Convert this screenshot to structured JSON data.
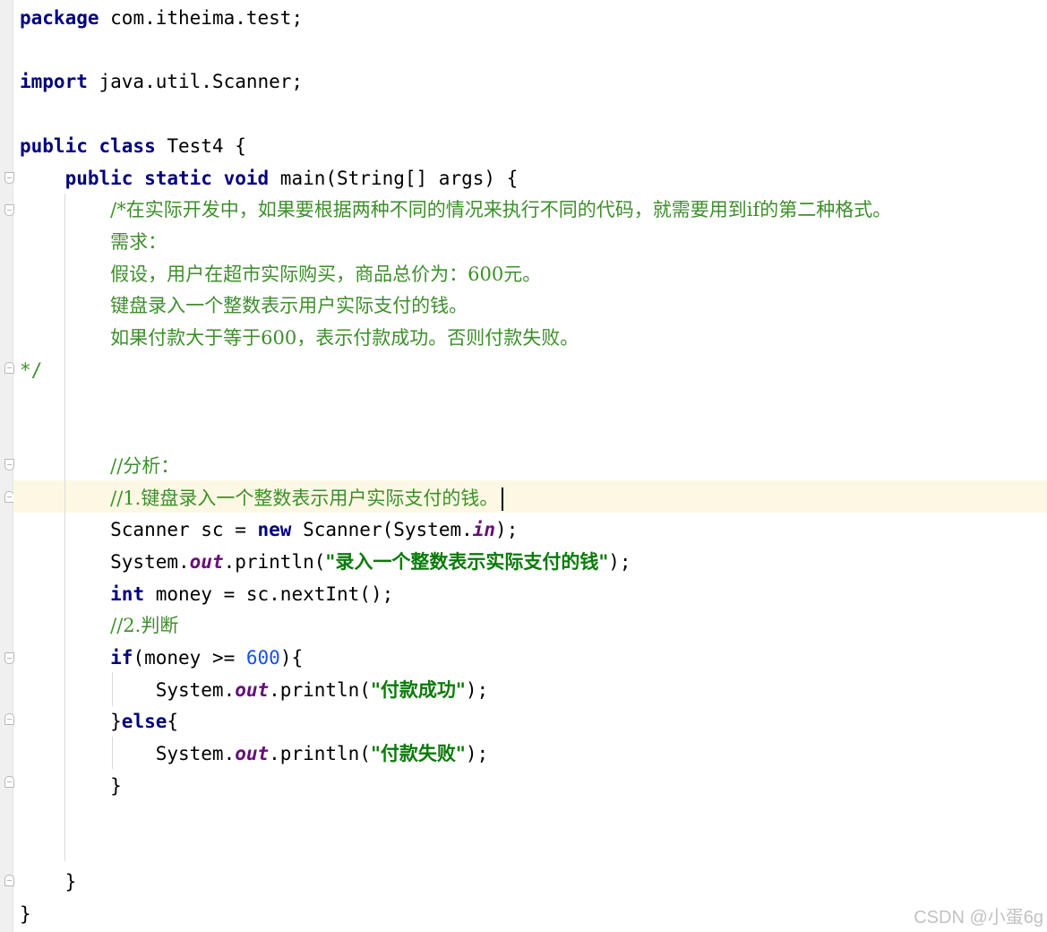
{
  "editor": {
    "language": "java",
    "caret_line": 16,
    "lines": [
      {
        "parts": [
          {
            "t": "package",
            "s": "kw"
          },
          {
            "t": " com.itheima.test;"
          }
        ]
      },
      {
        "parts": []
      },
      {
        "parts": [
          {
            "t": "import",
            "s": "kw"
          },
          {
            "t": " java.util.Scanner;"
          }
        ]
      },
      {
        "parts": []
      },
      {
        "parts": [
          {
            "t": "public class",
            "s": "kw"
          },
          {
            "t": " Test4 {"
          }
        ]
      },
      {
        "parts": [
          {
            "t": "    "
          },
          {
            "t": "public static void",
            "s": "kw"
          },
          {
            "t": " main(String[] args) {"
          }
        ]
      },
      {
        "parts": [
          {
            "t": "        "
          },
          {
            "t": "/*在实际开发中，如果要根据两种不同的情况来执行不同的代码，就需要用到if的第二种格式。",
            "s": "cm"
          }
        ]
      },
      {
        "parts": [
          {
            "t": "        "
          },
          {
            "t": "需求：",
            "s": "cm"
          }
        ]
      },
      {
        "parts": [
          {
            "t": "        "
          },
          {
            "t": "假设，用户在超市实际购买，商品总价为：600元。",
            "s": "cm"
          }
        ]
      },
      {
        "parts": [
          {
            "t": "        "
          },
          {
            "t": "键盘录入一个整数表示用户实际支付的钱。",
            "s": "cm"
          }
        ]
      },
      {
        "parts": [
          {
            "t": "        "
          },
          {
            "t": "如果付款大于等于600，表示付款成功。否则付款失败。",
            "s": "cm"
          }
        ]
      },
      {
        "parts": [
          {
            "t": "*/",
            "s": "cmm"
          }
        ]
      },
      {
        "parts": []
      },
      {
        "parts": []
      },
      {
        "parts": [
          {
            "t": "        "
          },
          {
            "t": "//分析：",
            "s": "cm"
          }
        ]
      },
      {
        "parts": [
          {
            "t": "        "
          },
          {
            "t": "//1.键盘录入一个整数表示用户实际支付的钱。",
            "s": "cm"
          }
        ]
      },
      {
        "parts": [
          {
            "t": "        Scanner sc = "
          },
          {
            "t": "new",
            "s": "kw"
          },
          {
            "t": " Scanner(System."
          },
          {
            "t": "in",
            "s": "field"
          },
          {
            "t": ");"
          }
        ]
      },
      {
        "parts": [
          {
            "t": "        System."
          },
          {
            "t": "out",
            "s": "field"
          },
          {
            "t": ".println("
          },
          {
            "t": "\"录入一个整数表示实际支付的钱\"",
            "s": "str"
          },
          {
            "t": ");"
          }
        ]
      },
      {
        "parts": [
          {
            "t": "        "
          },
          {
            "t": "int",
            "s": "kw"
          },
          {
            "t": " money = sc.nextInt();"
          }
        ]
      },
      {
        "parts": [
          {
            "t": "        "
          },
          {
            "t": "//2.判断",
            "s": "cm"
          }
        ]
      },
      {
        "parts": [
          {
            "t": "        "
          },
          {
            "t": "if",
            "s": "kw"
          },
          {
            "t": "(money >= "
          },
          {
            "t": "600",
            "s": "num"
          },
          {
            "t": "){"
          }
        ]
      },
      {
        "parts": [
          {
            "t": "            System."
          },
          {
            "t": "out",
            "s": "field"
          },
          {
            "t": ".println("
          },
          {
            "t": "\"付款成功\"",
            "s": "str"
          },
          {
            "t": ");"
          }
        ]
      },
      {
        "parts": [
          {
            "t": "        }"
          },
          {
            "t": "else",
            "s": "kw"
          },
          {
            "t": "{"
          }
        ]
      },
      {
        "parts": [
          {
            "t": "            System."
          },
          {
            "t": "out",
            "s": "field"
          },
          {
            "t": ".println("
          },
          {
            "t": "\"付款失败\"",
            "s": "str"
          },
          {
            "t": ");"
          }
        ]
      },
      {
        "parts": [
          {
            "t": "        }"
          }
        ]
      },
      {
        "parts": []
      },
      {
        "parts": []
      },
      {
        "parts": [
          {
            "t": "    }"
          }
        ]
      },
      {
        "parts": [
          {
            "t": "}"
          }
        ]
      }
    ]
  },
  "watermark": "CSDN @小蛋6g"
}
